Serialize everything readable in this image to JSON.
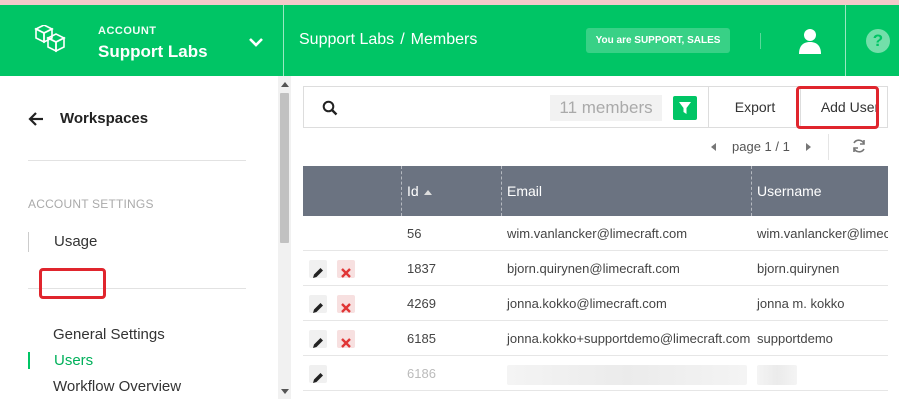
{
  "header": {
    "account_label": "ACCOUNT",
    "account_name": "Support Labs",
    "breadcrumb": [
      "Support Labs",
      "/",
      "Members"
    ],
    "role_badge": "You are SUPPORT, SALES",
    "icons": [
      "logo-cubes-icon",
      "chevron-down-icon",
      "user-icon",
      "help-icon"
    ],
    "help_glyph": "?"
  },
  "sidebar": {
    "back_label": "Workspaces",
    "section_label": "ACCOUNT SETTINGS",
    "items": [
      {
        "label": "Usage"
      },
      {
        "label": "General Settings"
      },
      {
        "label": "Users",
        "active": true
      },
      {
        "label": "Workflow Overview"
      }
    ]
  },
  "toolbar": {
    "search_placeholder": "",
    "member_count": "11 members",
    "export_label": "Export",
    "add_user_label": "Add User"
  },
  "pager": {
    "page_text": "page 1 / 1"
  },
  "table": {
    "columns": [
      "Id",
      "Email",
      "Username"
    ],
    "rows": [
      {
        "id": "56",
        "email": "wim.vanlancker@limecraft.com",
        "username": "wim.vanlancker@limecraft.com",
        "actions": []
      },
      {
        "id": "1837",
        "email": "bjorn.quirynen@limecraft.com",
        "username": "bjorn.quirynen",
        "actions": [
          "edit",
          "delete"
        ]
      },
      {
        "id": "4269",
        "email": "jonna.kokko@limecraft.com",
        "username": "jonna m. kokko",
        "actions": [
          "edit",
          "delete"
        ]
      },
      {
        "id": "6185",
        "email": "jonna.kokko+supportdemo@limecraft.com",
        "username": "supportdemo",
        "actions": [
          "edit",
          "delete"
        ]
      },
      {
        "id": "6186",
        "email": "",
        "username": "",
        "actions": [
          "edit"
        ]
      }
    ]
  },
  "colors": {
    "brand_green": "#00c565",
    "table_header": "#6b7381",
    "highlight_red": "#e0252d",
    "delete_red": "#e03535"
  }
}
